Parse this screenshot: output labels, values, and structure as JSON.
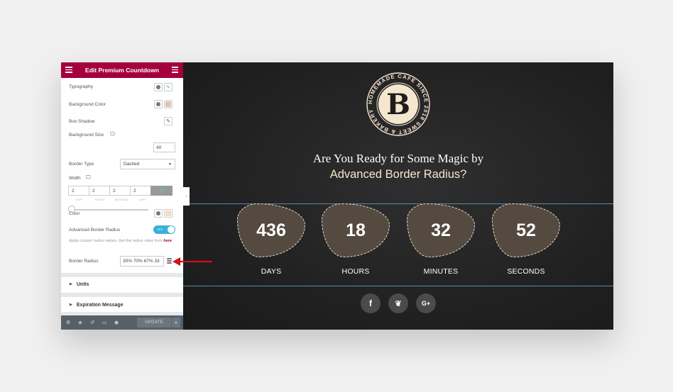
{
  "panel": {
    "title": "Edit Premium Countdown",
    "typography_label": "Typography",
    "background_color_label": "Background Color",
    "box_shadow_label": "Box Shadow",
    "background_size_label": "Background Size",
    "background_size_value": "40",
    "border_type_label": "Border Type",
    "border_type_value": "Dashed",
    "width_label": "Width",
    "width_values": {
      "top": "2",
      "right": "2",
      "bottom": "2",
      "left": "2"
    },
    "width_sublabels": {
      "top": "TOP",
      "right": "RIGHT",
      "bottom": "BOTTOM",
      "left": "LEFT"
    },
    "color_label": "Color",
    "advanced_border_radius_label": "Advanced Border Radius",
    "toggle_text": "YES",
    "toggle_on": true,
    "help_text": "Apply custom radius values. Get the radius value from ",
    "help_link": "here",
    "border_radius_label": "Border Radius",
    "border_radius_value": "30% 70% 67% 33",
    "sections": [
      "Units",
      "Expiration Message"
    ],
    "update_button": "UPDATE",
    "colors": {
      "header": "#a4003c",
      "bg_swatch": "#d8c6b8",
      "color_swatch": "#f7dcc0",
      "toggle": "#39b0d9"
    }
  },
  "preview": {
    "logo_letter": "B",
    "logo_ring_text": "HOMEMADE CAFE SINCE 2018 SWEET & BAKERY ",
    "heading_line1": "Are You Ready for Some Magic by",
    "heading_line2": "Advanced Border Radius?",
    "countdown": [
      {
        "value": "436",
        "label": "DAYS"
      },
      {
        "value": "18",
        "label": "HOURS"
      },
      {
        "value": "32",
        "label": "MINUTES"
      },
      {
        "value": "52",
        "label": "SECONDS"
      }
    ],
    "social": [
      {
        "icon": "facebook-icon",
        "glyph": "f"
      },
      {
        "icon": "twitter-icon",
        "glyph": "❦"
      },
      {
        "icon": "google-plus-icon",
        "glyph": "G+"
      }
    ],
    "colors": {
      "blob": "#554a40",
      "accent_text": "#f5e6cf",
      "line": "#6aa6c8"
    }
  }
}
